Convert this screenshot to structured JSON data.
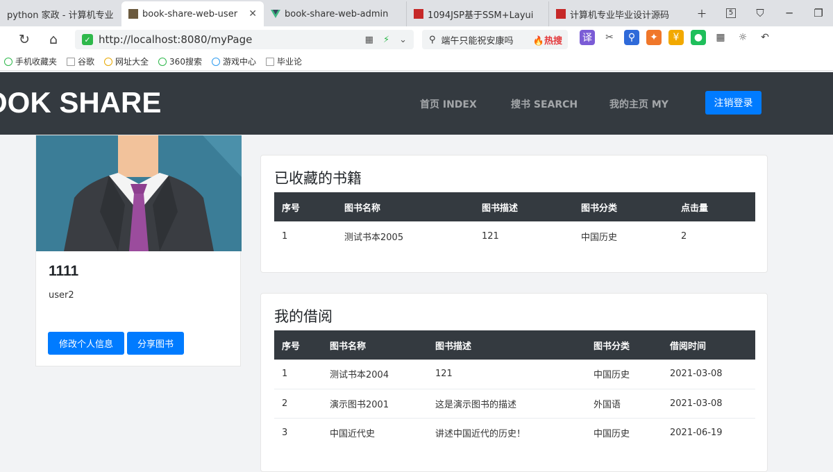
{
  "browser": {
    "tabs": [
      {
        "label": "python 家政 - 计算机专业",
        "favicon_color": "#dfe1e5",
        "active": false
      },
      {
        "label": "book-share-web-user",
        "favicon_color": "#6b5a3e",
        "active": true
      },
      {
        "label": "book-share-web-admin",
        "favicon_color": "#2e8b6e",
        "active": false
      },
      {
        "label": "1094JSP基于SSM+Layui",
        "favicon_color": "#c62828",
        "active": false
      },
      {
        "label": "计算机专业毕业设计源码",
        "favicon_color": "#c62828",
        "active": false
      }
    ],
    "tab_count": "5",
    "address": {
      "url": "http://localhost:8080/myPage"
    },
    "search": {
      "text": "端午只能祝安康吗",
      "hot_label": "热搜"
    },
    "extensions": [
      {
        "icon": "translate-icon",
        "glyph": "译",
        "color": "#7b5cd6"
      },
      {
        "icon": "scissors-icon",
        "glyph": "✂",
        "color": "#555555"
      },
      {
        "icon": "magnifier-icon",
        "glyph": "⚲",
        "color": "#2f6ad9"
      },
      {
        "icon": "game-icon",
        "glyph": "✦",
        "color": "#f0772a"
      },
      {
        "icon": "coin-icon",
        "glyph": "¥",
        "color": "#f2a900"
      },
      {
        "icon": "refresh-circle-icon",
        "glyph": "●",
        "color": "#1fbf5b"
      },
      {
        "icon": "grid-icon",
        "glyph": "▦",
        "color": "#444444"
      },
      {
        "icon": "sun-icon",
        "glyph": "☼",
        "color": "#444444"
      },
      {
        "icon": "undo-icon",
        "glyph": "↶",
        "color": "#444444"
      }
    ],
    "bookmarks": [
      {
        "label": "手机收藏夹",
        "icon": "phone-icon"
      },
      {
        "label": "谷歌",
        "icon": "page-icon"
      },
      {
        "label": "网址大全",
        "icon": "globe-icon"
      },
      {
        "label": "360搜索",
        "icon": "search360-icon"
      },
      {
        "label": "游戏中心",
        "icon": "game-center-icon"
      },
      {
        "label": "毕业论",
        "icon": "page-icon"
      }
    ]
  },
  "site": {
    "logo": "OOK SHARE",
    "nav": [
      {
        "label": "首页 INDEX"
      },
      {
        "label": "搜书 SEARCH"
      },
      {
        "label": "我的主页 MY"
      }
    ],
    "logout_label": "注销登录"
  },
  "profile": {
    "name": "1111",
    "account": "user2",
    "edit_label": "修改个人信息",
    "share_label": "分享图书"
  },
  "favorites": {
    "title": "已收藏的书籍",
    "columns": [
      "序号",
      "图书名称",
      "图书描述",
      "图书分类",
      "点击量"
    ],
    "rows": [
      [
        "1",
        "测试书本2005",
        "121",
        "中国历史",
        "2"
      ]
    ]
  },
  "borrows": {
    "title": "我的借阅",
    "columns": [
      "序号",
      "图书名称",
      "图书描述",
      "图书分类",
      "借阅时间"
    ],
    "rows": [
      [
        "1",
        "测试书本2004",
        "121",
        "中国历史",
        "2021-03-08"
      ],
      [
        "2",
        "演示图书2001",
        "这是演示图书的描述",
        "外国语",
        "2021-03-08"
      ],
      [
        "3",
        "中国近代史",
        "讲述中国近代的历史！",
        "中国历史",
        "2021-06-19"
      ]
    ]
  },
  "colors": {
    "primary": "#007bff",
    "dark": "#343a40"
  }
}
